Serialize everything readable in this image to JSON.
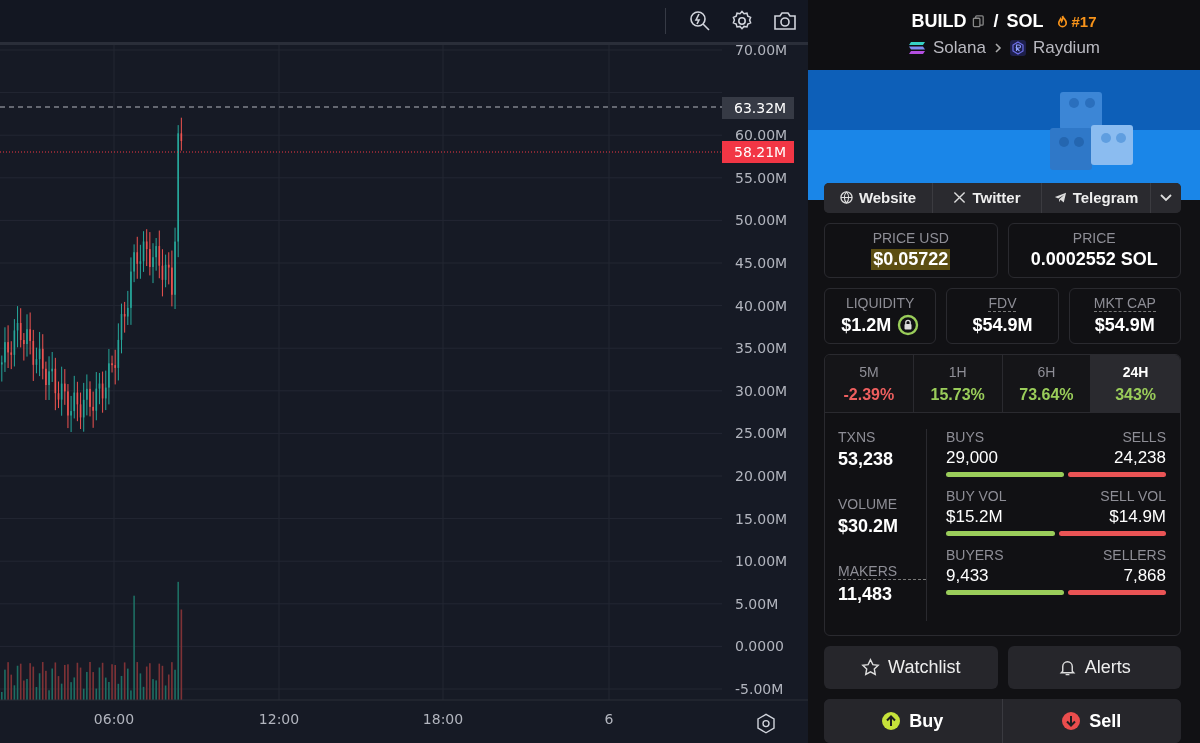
{
  "chart": {
    "price_axis": [
      "70.00M",
      "60.00M",
      "55.00M",
      "50.00M",
      "45.00M",
      "40.00M",
      "35.00M",
      "30.00M",
      "25.00M",
      "20.00M",
      "15.00M",
      "10.00M",
      "5.00M",
      "0.0000",
      "-5.00M"
    ],
    "time_axis": [
      "06:00",
      "12:00",
      "18:00",
      "6"
    ],
    "crosshair_label": "63.32M",
    "last_price_label": "58.21M"
  },
  "pair": {
    "base": "BUILD",
    "separator": "/",
    "quote": "SOL",
    "trending_rank": "#17",
    "chain": "Solana",
    "dex": "Raydium"
  },
  "links": [
    {
      "label": "Website",
      "kind": "website"
    },
    {
      "label": "Twitter",
      "kind": "twitter"
    },
    {
      "label": "Telegram",
      "kind": "telegram"
    }
  ],
  "prices": [
    {
      "label": "PRICE USD",
      "value": "$0.05722",
      "highlighted": true
    },
    {
      "label": "PRICE",
      "value": "0.0002552 SOL",
      "highlighted": false
    }
  ],
  "metrics": [
    {
      "label": "LIQUIDITY",
      "value": "$1.2M",
      "locked": true,
      "dotted": false
    },
    {
      "label": "FDV",
      "value": "$54.9M",
      "locked": false,
      "dotted": true
    },
    {
      "label": "MKT CAP",
      "value": "$54.9M",
      "locked": false,
      "dotted": true
    }
  ],
  "periods": [
    {
      "label": "5M",
      "change": "-2.39%",
      "negative": true,
      "selected": false
    },
    {
      "label": "1H",
      "change": "15.73%",
      "negative": false,
      "selected": false
    },
    {
      "label": "6H",
      "change": "73.64%",
      "negative": false,
      "selected": false
    },
    {
      "label": "24H",
      "change": "343%",
      "negative": false,
      "selected": true
    }
  ],
  "totals": [
    {
      "label": "TXNS",
      "value": "53,238",
      "dotted": false
    },
    {
      "label": "VOLUME",
      "value": "$30.2M",
      "dotted": false
    },
    {
      "label": "MAKERS",
      "value": "11,483",
      "dotted": true
    }
  ],
  "splits": [
    {
      "buy_label": "BUYS",
      "buy_value": "29,000",
      "sell_label": "SELLS",
      "sell_value": "24,238",
      "level": 0.545
    },
    {
      "buy_label": "BUY VOL",
      "buy_value": "$15.2M",
      "sell_label": "SELL VOL",
      "sell_value": "$14.9M",
      "level": 0.505
    },
    {
      "buy_label": "BUYERS",
      "buy_value": "9,433",
      "sell_label": "SELLERS",
      "sell_value": "7,868",
      "level": 0.545
    }
  ],
  "actions": [
    {
      "label": "Watchlist",
      "kind": "watchlist"
    },
    {
      "label": "Alerts",
      "kind": "alerts"
    }
  ],
  "trade": [
    {
      "label": "Buy",
      "kind": "buy"
    },
    {
      "label": "Sell",
      "kind": "sell"
    }
  ]
}
